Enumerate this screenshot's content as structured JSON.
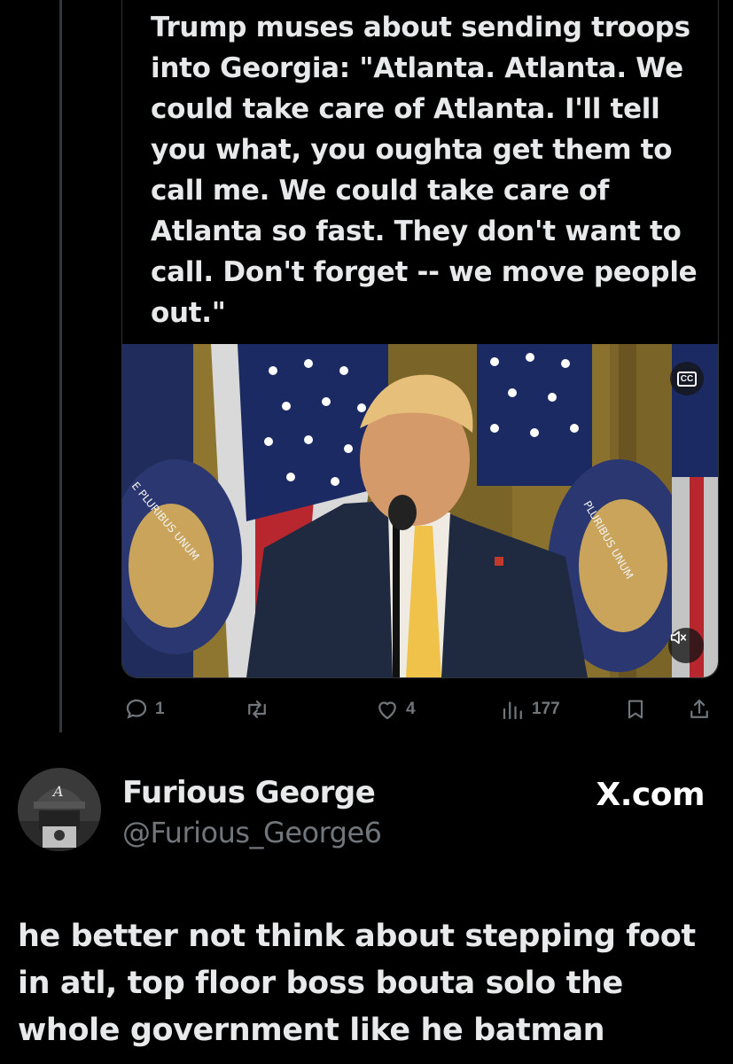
{
  "quoted_post": {
    "text": "Trump muses about sending troops into Georgia: \"Atlanta. Atlanta. We could take care of Atlanta. I'll tell you what, you oughta get them to call me. We could take care of Atlanta so fast. They don't want to call. Don't forget -- we move people out.\"",
    "video": {
      "cc_label": "CC",
      "cc_icon": "closed-captions-icon",
      "mute_icon": "volume-muted-icon",
      "seal_text_left": "E PLURIBUS UNUM",
      "seal_text_right": "PLURIBUS UNUM"
    }
  },
  "actions": {
    "reply": {
      "icon": "reply-icon",
      "count": "1"
    },
    "repost": {
      "icon": "repost-icon",
      "count": ""
    },
    "like": {
      "icon": "heart-icon",
      "count": "4"
    },
    "views": {
      "icon": "views-icon",
      "count": "177"
    },
    "bookmark": {
      "icon": "bookmark-icon"
    },
    "share": {
      "icon": "share-icon"
    }
  },
  "author": {
    "name": "Furious George",
    "handle": "@Furious_George6",
    "avatar_icon": "user-avatar"
  },
  "brand": "X.com",
  "reply_text": "he better not think about stepping foot in atl, top floor boss bouta solo the whole government like he batman",
  "colors": {
    "background": "#000000",
    "text": "#e7e9ea",
    "muted": "#71767b",
    "tie": "#f0c24a",
    "suit": "#1f2940"
  }
}
